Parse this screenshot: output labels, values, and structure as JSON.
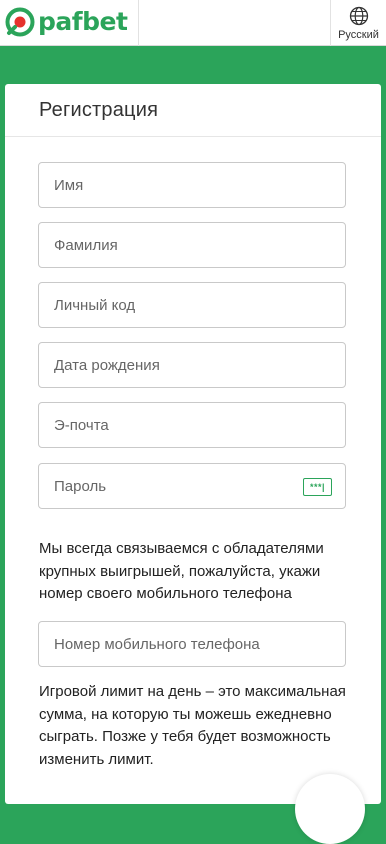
{
  "header": {
    "brand": "pafbet",
    "language_label": "Русский",
    "brand_color": "#2ba45a"
  },
  "form": {
    "title": "Регистрация",
    "fields": {
      "first_name": "Имя",
      "last_name": "Фамилия",
      "personal_code": "Личный код",
      "birth_date": "Дата рождения",
      "email": "Э-почта",
      "password": "Пароль",
      "phone": "Номер мобильного телефона"
    },
    "password_toggle_text": "***|",
    "phone_info": "Мы всегда связываемся с обладателями крупных выигрышей, пожалуйста, укажи номер своего мобильного телефона",
    "limit_info": "Игровой лимит на день – это максимальная сумма, на которую ты можешь ежедневно сыграть. Позже у тебя будет возможность изменить лимит."
  }
}
